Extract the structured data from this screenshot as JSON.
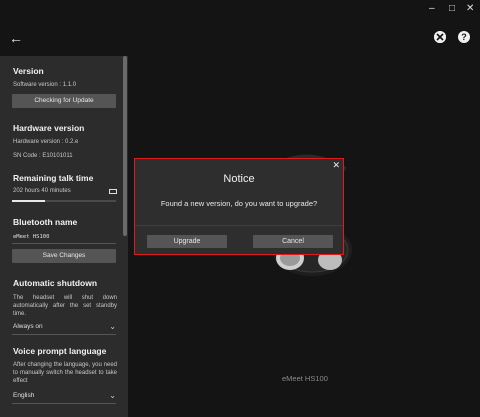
{
  "window": {
    "minimize": "–",
    "maximize": "□",
    "close": "✕"
  },
  "header": {
    "back_icon": "back-arrow-icon",
    "profile_icon": "xbox-icon",
    "help_icon": "help-icon",
    "help_glyph": "?"
  },
  "sidebar": {
    "version": {
      "title": "Version",
      "software_version": "Software version : 1.1.0",
      "check_button": "Checking for Update"
    },
    "hardware": {
      "title": "Hardware version",
      "hardware_version": "Hardware version : 0.2.e",
      "sn_code": "SN Code : E10101011"
    },
    "talk_time": {
      "title": "Remaining talk time",
      "value": "202 hours 40 minutes",
      "progress": 0.32
    },
    "bluetooth": {
      "title": "Bluetooth name",
      "value": "eMeet HS100",
      "save_button": "Save Changes"
    },
    "shutdown": {
      "title": "Automatic shutdown",
      "description": "The headset will shut down automatically after the set standby time.",
      "selected": "Always on"
    },
    "voice_prompt": {
      "title": "Voice prompt language",
      "description": "After changing the language, you need to manually switch the headset to take effect",
      "selected": "English"
    }
  },
  "device_name": "eMeet HS100",
  "dialog": {
    "title": "Notice",
    "message": "Found a new version, do you want to upgrade?",
    "upgrade_button": "Upgrade",
    "cancel_button": "Cancel",
    "close_glyph": "✕"
  },
  "colors": {
    "dialog_border": "#e01b1b",
    "background": "#141414",
    "panel": "#2c2c2c"
  }
}
